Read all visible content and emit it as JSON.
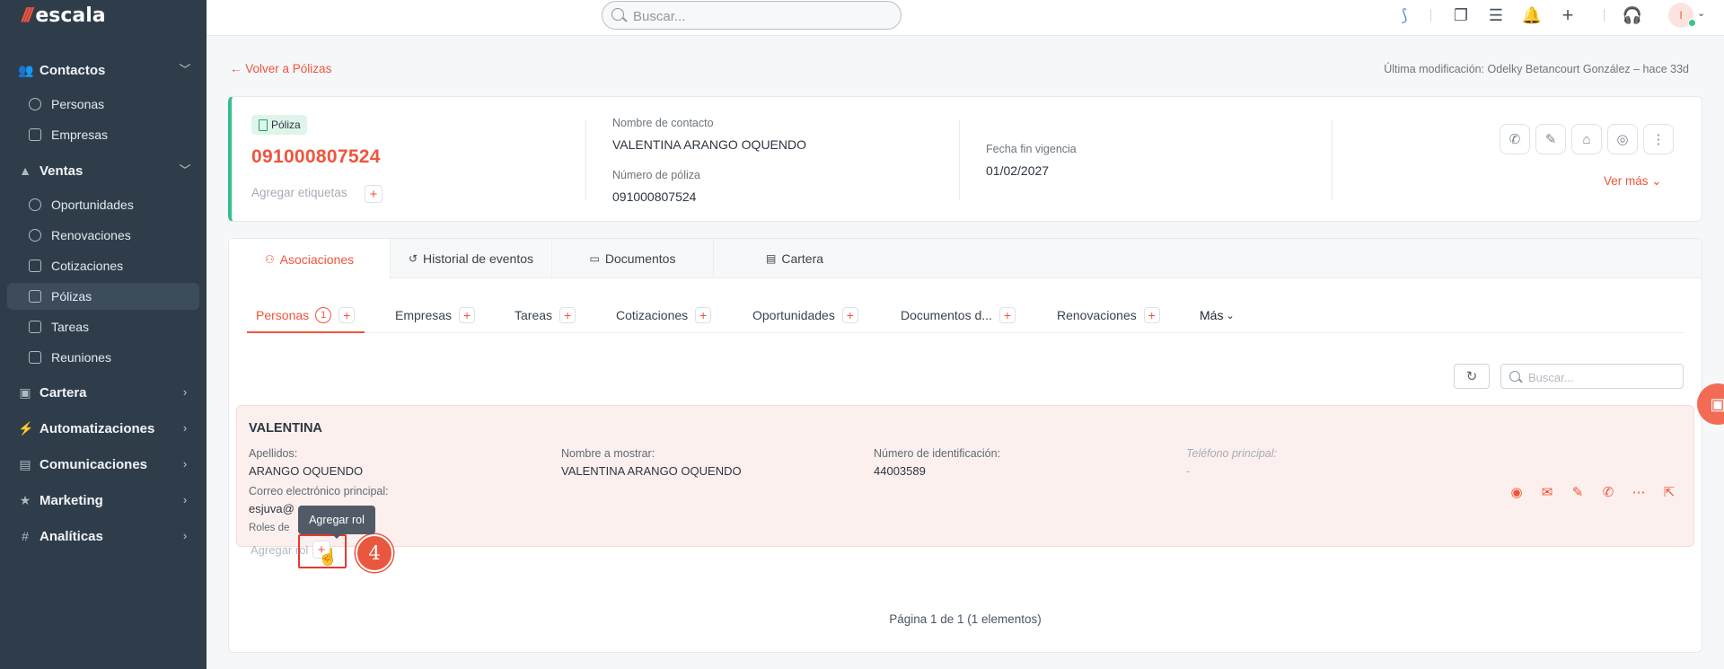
{
  "app": {
    "logo_text": "escala"
  },
  "search": {
    "placeholder": "Buscar..."
  },
  "sidebar": {
    "sections": [
      {
        "label": "Contactos"
      },
      {
        "label": "Ventas"
      },
      {
        "label": "Cartera"
      },
      {
        "label": "Automatizaciones"
      },
      {
        "label": "Comunicaciones"
      },
      {
        "label": "Marketing"
      },
      {
        "label": "Analíticas"
      }
    ],
    "items": [
      {
        "label": "Personas"
      },
      {
        "label": "Empresas"
      },
      {
        "label": "Oportunidades"
      },
      {
        "label": "Renovaciones"
      },
      {
        "label": "Cotizaciones"
      },
      {
        "label": "Pólizas"
      },
      {
        "label": "Tareas"
      },
      {
        "label": "Reuniones"
      }
    ]
  },
  "topbar": {
    "avatar_initial": "I"
  },
  "page": {
    "back_link": "Volver a Pólizas",
    "last_modified": "Última modificación: Odelky Betancourt González – hace 33d"
  },
  "record": {
    "tag": "Póliza",
    "number": "091000807524",
    "add_tags_label": "Agregar etiquetas",
    "contact_label": "Nombre de contacto",
    "contact_value": "VALENTINA ARANGO OQUENDO",
    "policy_label": "Número de póliza",
    "policy_value": "091000807524",
    "end_label": "Fecha fin vigencia",
    "end_value": "01/02/2027",
    "ver_mas": "Ver más"
  },
  "tabs": [
    {
      "label": "Asociaciones"
    },
    {
      "label": "Historial de eventos"
    },
    {
      "label": "Documentos"
    },
    {
      "label": "Cartera"
    }
  ],
  "subtabs": [
    {
      "label": "Personas",
      "count": "1"
    },
    {
      "label": "Empresas"
    },
    {
      "label": "Tareas"
    },
    {
      "label": "Cotizaciones"
    },
    {
      "label": "Oportunidades"
    },
    {
      "label": "Documentos d..."
    },
    {
      "label": "Renovaciones"
    },
    {
      "label": "Más"
    }
  ],
  "inner_search": {
    "placeholder": "Buscar..."
  },
  "person": {
    "name": "VALENTINA",
    "apellidos_label": "Apellidos:",
    "apellidos_value": "ARANGO OQUENDO",
    "display_label": "Nombre a mostrar:",
    "display_value": "VALENTINA ARANGO OQUENDO",
    "id_label": "Número de identificación:",
    "id_value": "44003589",
    "phone_label": "Teléfono principal:",
    "phone_value": "-",
    "email_label": "Correo electrónico principal:",
    "email_value": "esjuva@",
    "roles_label": "Roles de",
    "add_role_label": "Agregar rol"
  },
  "tooltip": {
    "text": "Agregar rol"
  },
  "step_marker": "4",
  "pagination": "Página 1 de 1 (1 elementos)",
  "colors": {
    "accent": "#f0543c",
    "sidebar_bg": "#2f3d4b",
    "success": "#34c08a"
  }
}
